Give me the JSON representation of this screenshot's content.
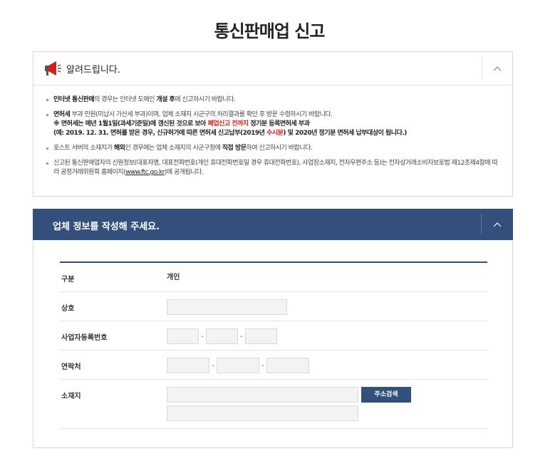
{
  "page": {
    "title": "통신판매업 신고"
  },
  "notice": {
    "title": "알려드립니다.",
    "items": [
      {
        "strong": "인터넷 통신판매",
        "text": "의 경우는 인터넷 도메인 ",
        "strong2": "개설 후",
        "text2": "에 신고하시기 바랍니다."
      },
      {
        "strong": "면허세",
        "text": " 부과 민원(미납시 가산세 부과)이며, 업체 소재지 시군구의 처리결과를 확인 후 방문 수령하시기 바랍니다.",
        "sub1_a": "※ 면허세는 매년 1월1일(과세기준일)에 갱신된 것으로 보아 ",
        "sub1_red": "폐업신고 전까지",
        "sub1_b": " 정기분 등록면허세 부과",
        "sub2_a": "(예: 2019. 12. 31. 면허를 받은 경우, 신규허가에 따른 면허세 신고납부(2019년 ",
        "sub2_red": "수시분",
        "sub2_b": ") 및 2020년 정기분 면허세 납부대상이 됩니다.)"
      },
      {
        "text": "호스트 서버의 소재지가 ",
        "strong": "해외",
        "text2": "인 경우에는 업체 소재지의 시군구청에 ",
        "strong2": "직접 방문",
        "text3": "하여 신고하시기 바랍니다."
      },
      {
        "text": "신고된 통신판매업자의 신원정보(대표자명, 대표전화번호(개인 휴대전화번호일 경우 휴대전화번호), 사업장소재지, 전자우편주소 등)는 전자상거래소비자보호법 제12조제4항에 따라 공정거래위원회 홈페이지(",
        "link": "www.ftc.go.kr",
        "text2": ")에 공개됩니다."
      }
    ]
  },
  "company": {
    "title": "업체 정보를 작성해 주세요.",
    "rows": {
      "type": {
        "label": "구분",
        "value": "개인"
      },
      "name": {
        "label": "상호",
        "value": ""
      },
      "bizno": {
        "label": "사업자등록번호",
        "dash": "-"
      },
      "contact": {
        "label": "연락처",
        "dash": "-"
      },
      "address": {
        "label": "소재지",
        "button": "주소검색"
      }
    }
  },
  "colors": {
    "accent": "#33507d",
    "red": "#d51f1f"
  },
  "icons": {
    "notice": "megaphone-icon",
    "collapse": "chevron-up-icon"
  }
}
